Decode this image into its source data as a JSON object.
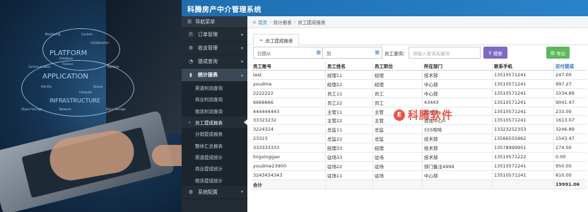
{
  "app": {
    "title": "科腾房产中介管理系统"
  },
  "background": {
    "cloud_labels": [
      "PLATFORM",
      "APPLICATION",
      "INFRASTRUCTURE"
    ],
    "small_labels": [
      "Monitoring",
      "Content",
      "Finance",
      "Collaboration",
      "Communication",
      "Identity",
      "Queue",
      "Object Storage",
      "Compute",
      "Block Storage",
      "Network",
      "Database",
      "Runtime"
    ]
  },
  "sidebar": {
    "header": "导航菜单",
    "items": [
      {
        "label": "订单管理",
        "icon": "p-circle-icon"
      },
      {
        "label": "收支管理",
        "icon": "gear-icon"
      },
      {
        "label": "提成查询",
        "icon": "chart-icon"
      },
      {
        "label": "统计报表",
        "icon": "bar-chart-icon"
      }
    ],
    "subitems": [
      "渠道利润查询",
      "商业利润查询",
      "租赁利润查询",
      "员工提成报表",
      "分销提成报表",
      "整体汇总报表",
      "渠道提成统计",
      "商业提成统计",
      "租赁提成统计"
    ],
    "footer": {
      "label": "系统配置",
      "icon": "gear-icon"
    }
  },
  "breadcrumb": {
    "home": "首页",
    "level1": "统计报表",
    "level2": "员工提成报表"
  },
  "tab": {
    "label": "员工提成报表"
  },
  "filters": {
    "date_from": "日期从",
    "to": "到",
    "employee_label": "员工查询：",
    "search_placeholder": "请输入查询关键词",
    "search_button": "搜索",
    "export_button": "导出"
  },
  "table": {
    "headers": [
      "员工账号",
      "员工姓名",
      "员工职位",
      "所在部门",
      "联系手机",
      "应付提成"
    ],
    "rows": [
      [
        "test",
        "经理11",
        "经理",
        "技术部",
        "13510571241",
        "247.00"
      ],
      [
        "youdme",
        "经理22",
        "经理",
        "中心部",
        "13510571241",
        "997.27"
      ],
      [
        "2222222",
        "员工11",
        "员工",
        "中心部",
        "13510571241",
        "1034.89"
      ],
      [
        "6666666",
        "员工22",
        "员工",
        "43443",
        "13510571241",
        "9041.47"
      ],
      [
        "444444443",
        "主管11",
        "主管",
        "技术部",
        "13510571241",
        "233.00"
      ],
      [
        "33323232",
        "主管22",
        "主管",
        "管理中心0",
        "13510571241",
        "1613.07"
      ],
      [
        "3224324",
        "总监11",
        "总监",
        "555哈哈",
        "13323252353",
        "3246.89"
      ],
      [
        "23323",
        "总监22",
        "总监",
        "技术部",
        "13566555662",
        "1543.47"
      ],
      [
        "333333333",
        "经理33",
        "经理",
        "技术部",
        "13578999951",
        "274.00"
      ],
      [
        "lingxinggao",
        "驻场33",
        "驻场",
        "技术部",
        "13510571222",
        "0.00"
      ],
      [
        "youdme23900",
        "驻场22",
        "驻场",
        "部门备注4999",
        "13510571241",
        "950.00"
      ],
      [
        "3243434343",
        "驻场11",
        "驻场",
        "中心部",
        "13510571241",
        "810.00"
      ]
    ],
    "total_label": "合计",
    "total_value": "19991.06"
  },
  "watermark": {
    "logo_letter": "E",
    "text": "科腾软件"
  }
}
